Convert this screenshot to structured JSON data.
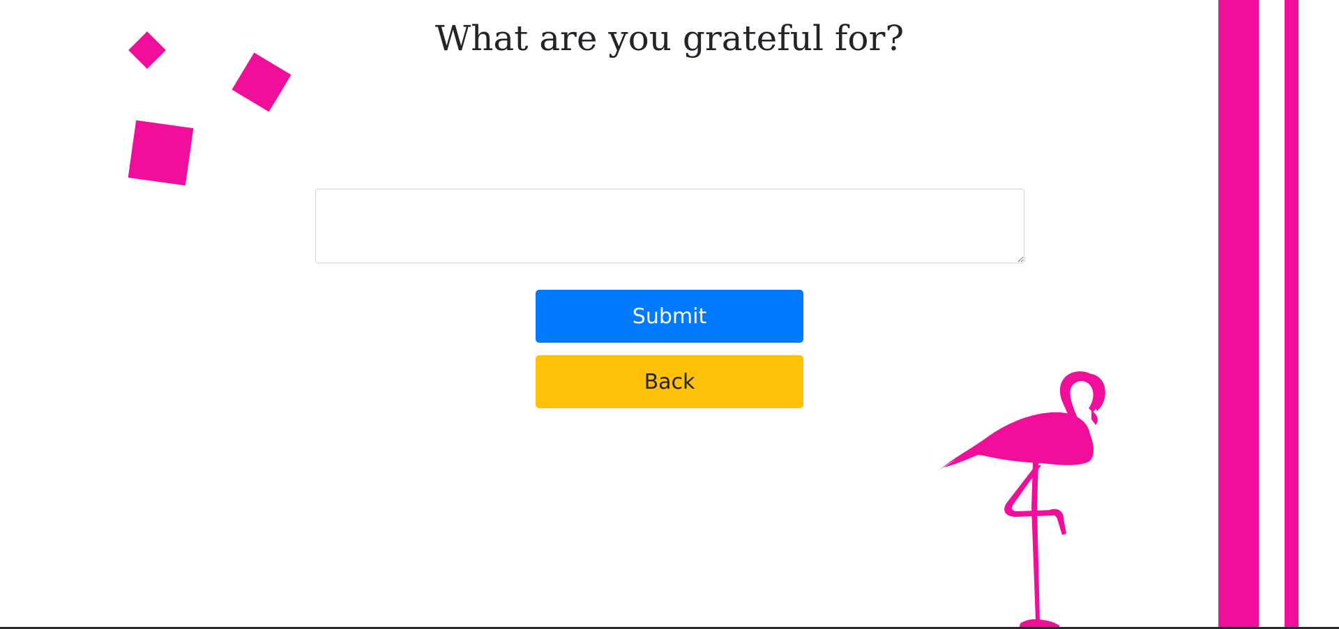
{
  "page": {
    "title": "What are you grateful for?"
  },
  "form": {
    "entry_value": "",
    "entry_placeholder": ""
  },
  "buttons": {
    "submit_label": "Submit",
    "back_label": "Back"
  },
  "colors": {
    "accent_pink": "#F00E9A",
    "submit_blue": "#007BFF",
    "back_yellow": "#FFC107",
    "title_text": "#212529"
  },
  "decorations": {
    "confetti_icon": "pink-square-icon",
    "flamingo_icon": "flamingo-icon"
  }
}
